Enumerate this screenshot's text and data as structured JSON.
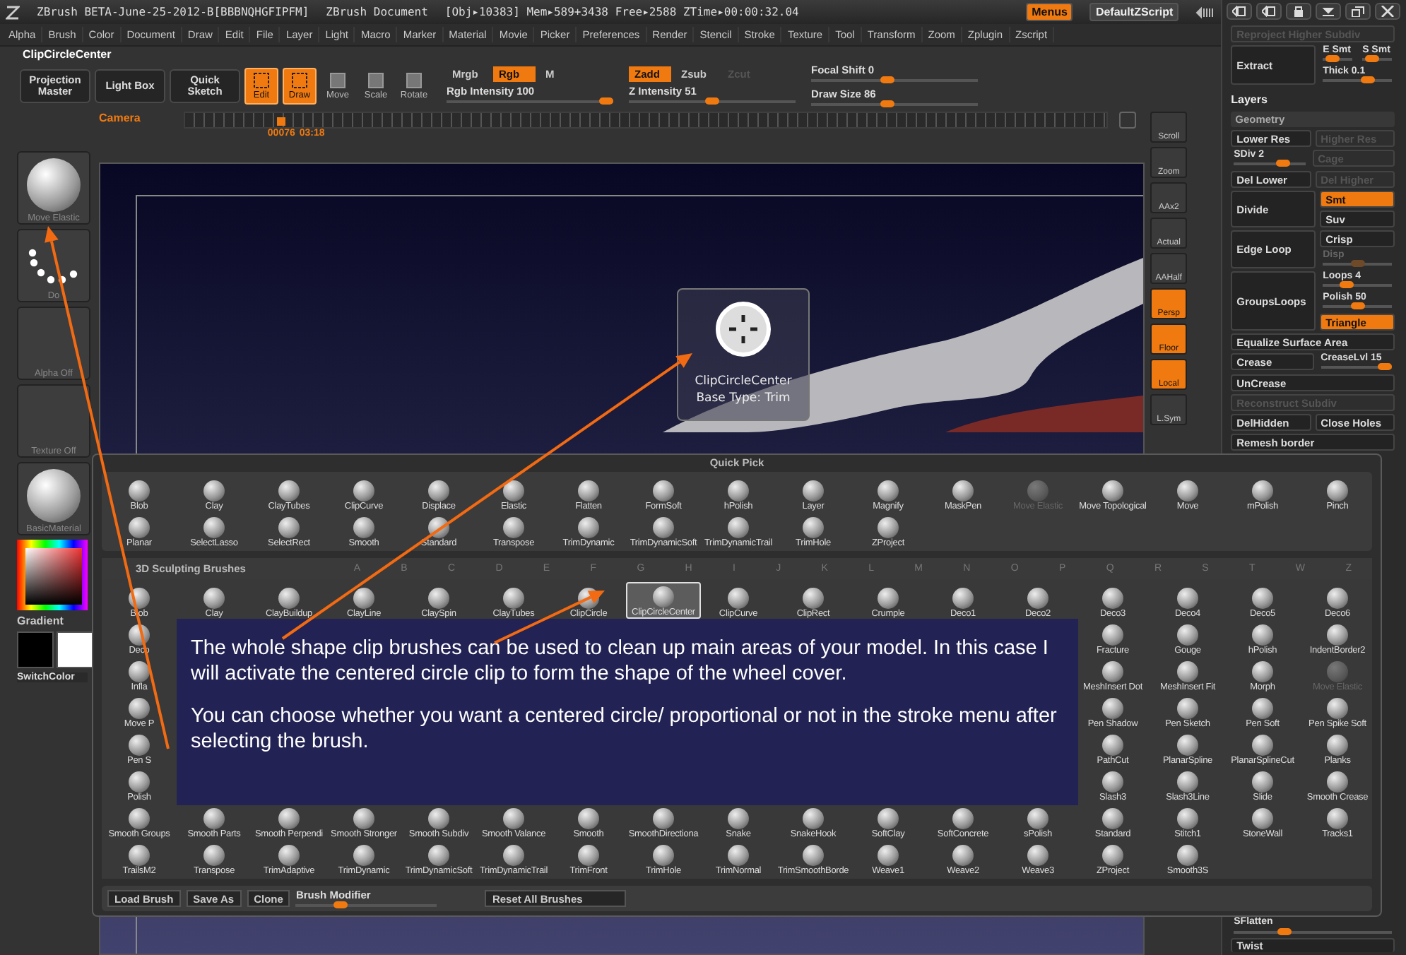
{
  "title_bar": {
    "app": "ZBrush BETA-June-25-2012-B[BBBNQHGFIPFM]",
    "document": "ZBrush Document",
    "stats": "[Obj▸10383] Mem▸589+3438 Free▸2588 ZTime▸00:00:32.04",
    "buttons": [
      {
        "label": "Menus",
        "selected": true
      },
      {
        "label": "DefaultZScript",
        "selected": false
      }
    ]
  },
  "menu_bar": [
    "Alpha",
    "Brush",
    "Color",
    "Document",
    "Draw",
    "Edit",
    "File",
    "Layer",
    "Light",
    "Macro",
    "Marker",
    "Material",
    "Movie",
    "Picker",
    "Preferences",
    "Render",
    "Stencil",
    "Stroke",
    "Texture",
    "Tool",
    "Transform",
    "Zoom",
    "Zplugin",
    "Zscript"
  ],
  "current_tool": "ClipCircleCenter",
  "toolbar": {
    "big_buttons": [
      "Projection Master",
      "Light Box",
      "Quick Sketch"
    ],
    "modes": [
      {
        "label": "Edit",
        "on": true
      },
      {
        "label": "Draw",
        "on": true
      },
      {
        "label": "Move",
        "on": false
      },
      {
        "label": "Scale",
        "on": false
      },
      {
        "label": "Rotate",
        "on": false
      }
    ],
    "groups": [
      {
        "toggles": [
          {
            "label": "Mrgb",
            "on": false,
            "disabled": false
          },
          {
            "label": "Rgb",
            "on": true,
            "disabled": false
          },
          {
            "label": "M",
            "on": false,
            "disabled": false
          }
        ],
        "sliders": [
          {
            "label": "Rgb Intensity 100",
            "level": 1
          }
        ]
      },
      {
        "toggles": [
          {
            "label": "Zadd",
            "on": true,
            "disabled": false
          },
          {
            "label": "Zsub",
            "on": false,
            "disabled": false
          },
          {
            "label": "Zcut",
            "on": false,
            "disabled": true
          }
        ],
        "sliders": [
          {
            "label": "Z Intensity 51",
            "level": 0.5
          }
        ]
      },
      {
        "sliders": [
          {
            "label": "Focal Shift 0",
            "level": 0.45
          },
          {
            "label": "Draw Size 86",
            "level": 0.45
          }
        ]
      }
    ]
  },
  "camera": {
    "label": "Camera",
    "level": 0.1,
    "frame": "00076",
    "time": "03:18"
  },
  "left_shelf": {
    "items": [
      {
        "kind": "sphere",
        "label": "Move Elastic"
      },
      {
        "kind": "dots",
        "label": "Do"
      },
      {
        "kind": "empty",
        "label": "Alpha Off"
      },
      {
        "kind": "empty",
        "label": "Texture Off"
      },
      {
        "kind": "sphere",
        "label": "BasicMaterial"
      }
    ],
    "gradient": "Gradient",
    "switch_color": "SwitchColor"
  },
  "right_shelf": [
    {
      "label": "Scroll",
      "on": false
    },
    {
      "label": "Zoom",
      "on": false
    },
    {
      "label": "AAx2",
      "on": false
    },
    {
      "label": "Actual",
      "on": false
    },
    {
      "label": "AAHalf",
      "on": false
    },
    {
      "label": "Persp",
      "on": true
    },
    {
      "label": "Floor",
      "on": true
    },
    {
      "label": "Local",
      "on": true
    },
    {
      "label": "L.Sym",
      "on": false
    }
  ],
  "tooltip": {
    "title": "ClipCircleCenter",
    "subtitle": "Base Type: Trim"
  },
  "right_panel": {
    "rows": [
      {
        "kind": "button",
        "label": "Reproject Higher Subdiv",
        "disabled": true
      },
      {
        "kind": "block",
        "button": "Extract",
        "items": [
          {
            "kind": "pair",
            "items": [
              {
                "kind": "slider",
                "label": "E Smt",
                "level": 0.2
              },
              {
                "kind": "slider",
                "label": "S Smt",
                "level": 0.2
              }
            ]
          },
          {
            "kind": "slider",
            "label": "Thick 0.1",
            "level": 0.7
          }
        ]
      },
      {
        "kind": "heading",
        "label": "Layers"
      },
      {
        "kind": "subheading",
        "label": "Geometry"
      },
      {
        "kind": "pair",
        "items": [
          {
            "kind": "button",
            "label": "Lower Res",
            "disabled": false
          },
          {
            "kind": "button",
            "label": "Higher Res",
            "disabled": true
          }
        ]
      },
      {
        "kind": "pair",
        "items": [
          {
            "kind": "slider",
            "label": "SDiv 2",
            "level": 0.75
          },
          {
            "kind": "button",
            "label": "Cage",
            "disabled": true
          }
        ]
      },
      {
        "kind": "pair",
        "items": [
          {
            "kind": "button",
            "label": "Del Lower",
            "disabled": false
          },
          {
            "kind": "button",
            "label": "Del Higher",
            "disabled": true
          }
        ]
      },
      {
        "kind": "block",
        "button": "Divide",
        "items": [
          {
            "kind": "toggle",
            "label": "Smt",
            "on": true
          },
          {
            "kind": "toggle",
            "label": "Suv",
            "on": false
          }
        ]
      },
      {
        "kind": "block",
        "button": "Edge Loop",
        "items": [
          {
            "kind": "toggle",
            "label": "Crisp",
            "on": false
          },
          {
            "kind": "slider",
            "label": "Disp",
            "level": 0.5,
            "disabled": true
          }
        ]
      },
      {
        "kind": "block",
        "button": "GroupsLoops",
        "items": [
          {
            "kind": "slider",
            "label": "Loops 4",
            "level": 0.3
          },
          {
            "kind": "slider",
            "label": "Polish 50",
            "level": 0.5
          },
          {
            "kind": "toggle",
            "label": "Triangle",
            "on": true
          }
        ]
      },
      {
        "kind": "button",
        "label": "Equalize Surface Area",
        "disabled": false
      },
      {
        "kind": "pair",
        "items": [
          {
            "kind": "button",
            "label": "Crease",
            "disabled": false
          },
          {
            "kind": "slider",
            "label": "CreaseLvl 15",
            "level": 1
          }
        ]
      },
      {
        "kind": "button",
        "label": "UnCrease",
        "disabled": false
      },
      {
        "kind": "button",
        "label": "Reconstruct Subdiv",
        "disabled": true
      },
      {
        "kind": "pair",
        "items": [
          {
            "kind": "button",
            "label": "DelHidden",
            "disabled": false
          },
          {
            "kind": "button",
            "label": "Close Holes",
            "disabled": false
          }
        ]
      },
      {
        "kind": "button",
        "label": "Remesh border",
        "disabled": false
      }
    ],
    "bottom_rows": [
      {
        "kind": "slider",
        "label": "SFlatten",
        "level": 0.3
      },
      {
        "kind": "button",
        "label": "Twist",
        "disabled": false
      }
    ]
  },
  "brush_palette": {
    "quick_pick": {
      "title": "Quick Pick",
      "rows": [
        [
          {
            "kind": "brush",
            "label": "Blob"
          },
          {
            "kind": "brush",
            "label": "Clay"
          },
          {
            "kind": "brush",
            "label": "ClayTubes"
          },
          {
            "kind": "brush",
            "label": "ClipCurve"
          },
          {
            "kind": "brush",
            "label": "Displace"
          },
          {
            "kind": "brush",
            "label": "Elastic"
          },
          {
            "kind": "brush",
            "label": "Flatten"
          },
          {
            "kind": "brush",
            "label": "FormSoft"
          },
          {
            "kind": "brush",
            "label": "hPolish"
          },
          {
            "kind": "brush",
            "label": "Layer"
          },
          {
            "kind": "brush",
            "label": "Magnify"
          },
          {
            "kind": "brush",
            "label": "MaskPen"
          },
          {
            "kind": "dim",
            "label": "Move Elastic"
          },
          {
            "kind": "brush",
            "label": "Move Topological"
          },
          {
            "kind": "brush",
            "label": "Move"
          },
          {
            "kind": "brush",
            "label": "mPolish"
          },
          {
            "kind": "brush",
            "label": "Pinch"
          }
        ],
        [
          {
            "kind": "brush",
            "label": "Planar"
          },
          {
            "kind": "brush",
            "label": "SelectLasso"
          },
          {
            "kind": "brush",
            "label": "SelectRect"
          },
          {
            "kind": "brush",
            "label": "Smooth"
          },
          {
            "kind": "brush",
            "label": "Standard"
          },
          {
            "kind": "brush",
            "label": "Transpose"
          },
          {
            "kind": "brush",
            "label": "TrimDynamic"
          },
          {
            "kind": "brush",
            "label": "TrimDynamicSoft"
          },
          {
            "kind": "brush",
            "label": "TrimDynamicTrail"
          },
          {
            "kind": "brush",
            "label": "TrimHole"
          },
          {
            "kind": "brush",
            "label": "ZProject"
          }
        ]
      ]
    },
    "library": {
      "title": "3D Sculpting Brushes",
      "letters": [
        "A",
        "B",
        "C",
        "D",
        "E",
        "F",
        "G",
        "H",
        "I",
        "J",
        "K",
        "L",
        "M",
        "N",
        "O",
        "P",
        "Q",
        "R",
        "S",
        "T",
        "W",
        "Z"
      ],
      "rows": [
        {
          "cells": [
            {
              "kind": "brush",
              "label": "Blob",
              "selected": false
            },
            {
              "kind": "brush",
              "label": "Clay",
              "selected": false
            },
            {
              "kind": "brush",
              "label": "ClayBuildup",
              "selected": false
            },
            {
              "kind": "brush",
              "label": "ClayLine",
              "selected": false
            },
            {
              "kind": "brush",
              "label": "ClaySpin",
              "selected": false
            },
            {
              "kind": "brush",
              "label": "ClayTubes",
              "selected": false
            },
            {
              "kind": "brush",
              "label": "ClipCircle",
              "selected": false
            },
            {
              "kind": "brush",
              "label": "ClipCircleCenter",
              "selected": true
            },
            {
              "kind": "brush",
              "label": "ClipCurve",
              "selected": false
            },
            {
              "kind": "brush",
              "label": "ClipRect",
              "selected": false
            },
            {
              "kind": "brush",
              "label": "Crumple",
              "selected": false
            },
            {
              "kind": "brush",
              "label": "Deco1",
              "selected": false
            },
            {
              "kind": "brush",
              "label": "Deco2",
              "selected": false
            },
            {
              "kind": "brush",
              "label": "Deco3",
              "selected": false
            },
            {
              "kind": "brush",
              "label": "Deco4",
              "selected": false
            },
            {
              "kind": "brush",
              "label": "Deco5",
              "selected": false
            },
            {
              "kind": "brush",
              "label": "Deco6",
              "selected": false
            }
          ]
        },
        {
          "cells": [
            {
              "kind": "brush",
              "label": "Deco",
              "selected": false
            }
          ],
          "after_gap": [
            {
              "kind": "brush",
              "label": "Fracture",
              "selected": false
            },
            {
              "kind": "brush",
              "label": "Gouge",
              "selected": false
            },
            {
              "kind": "brush",
              "label": "hPolish",
              "selected": false
            },
            {
              "kind": "brush",
              "label": "IndentBorder2",
              "selected": false
            }
          ]
        },
        {
          "cells": [
            {
              "kind": "brush",
              "label": "Infla",
              "selected": false
            }
          ],
          "after_gap": [
            {
              "kind": "brush",
              "label": "MeshInsert Dot",
              "selected": false
            },
            {
              "kind": "brush",
              "label": "MeshInsert Fit",
              "selected": false
            },
            {
              "kind": "brush",
              "label": "Morph",
              "selected": false
            },
            {
              "kind": "dim",
              "label": "Move Elastic",
              "selected": false
            }
          ]
        },
        {
          "cells": [
            {
              "kind": "brush",
              "label": "Move P",
              "selected": false
            }
          ],
          "after_gap": [
            {
              "kind": "brush",
              "label": "Pen Shadow",
              "selected": false
            },
            {
              "kind": "brush",
              "label": "Pen Sketch",
              "selected": false
            },
            {
              "kind": "brush",
              "label": "Pen Soft",
              "selected": false
            },
            {
              "kind": "brush",
              "label": "Pen Spike Soft",
              "selected": false
            }
          ]
        },
        {
          "cells": [
            {
              "kind": "brush",
              "label": "Pen S",
              "selected": false
            }
          ],
          "after_gap": [
            {
              "kind": "brush",
              "label": "PathCut",
              "selected": false
            },
            {
              "kind": "brush",
              "label": "PlanarSpline",
              "selected": false
            },
            {
              "kind": "brush",
              "label": "PlanarSplineCut",
              "selected": false
            },
            {
              "kind": "brush",
              "label": "Planks",
              "selected": false
            }
          ]
        },
        {
          "cells": [
            {
              "kind": "brush",
              "label": "Polish",
              "selected": false
            }
          ],
          "after_gap": [
            {
              "kind": "brush",
              "label": "Slash3",
              "selected": false
            },
            {
              "kind": "brush",
              "label": "Slash3Line",
              "selected": false
            },
            {
              "kind": "brush",
              "label": "Slide",
              "selected": false
            },
            {
              "kind": "brush",
              "label": "Smooth Crease",
              "selected": false
            }
          ]
        },
        {
          "cells": [
            {
              "kind": "brush",
              "label": "Smooth Groups",
              "selected": false
            },
            {
              "kind": "brush",
              "label": "Smooth Parts",
              "selected": false
            },
            {
              "kind": "brush",
              "label": "Smooth Perpendi",
              "selected": false
            },
            {
              "kind": "brush",
              "label": "Smooth Stronger",
              "selected": false
            },
            {
              "kind": "brush",
              "label": "Smooth Subdiv",
              "selected": false
            },
            {
              "kind": "brush",
              "label": "Smooth Valance",
              "selected": false
            },
            {
              "kind": "brush",
              "label": "Smooth",
              "selected": false
            },
            {
              "kind": "brush",
              "label": "SmoothDirectiona",
              "selected": false
            },
            {
              "kind": "brush",
              "label": "Snake",
              "selected": false
            },
            {
              "kind": "brush",
              "label": "SnakeHook",
              "selected": false
            },
            {
              "kind": "brush",
              "label": "SoftClay",
              "selected": false
            },
            {
              "kind": "brush",
              "label": "SoftConcrete",
              "selected": false
            },
            {
              "kind": "brush",
              "label": "sPolish",
              "selected": false
            },
            {
              "kind": "brush",
              "label": "Standard",
              "selected": false
            },
            {
              "kind": "brush",
              "label": "Stitch1",
              "selected": false
            },
            {
              "kind": "brush",
              "label": "StoneWall",
              "selected": false
            },
            {
              "kind": "brush",
              "label": "Tracks1",
              "selected": false
            }
          ]
        },
        {
          "cells": [
            {
              "kind": "brush",
              "label": "TrailsM2",
              "selected": false
            },
            {
              "kind": "brush",
              "label": "Transpose",
              "selected": false
            },
            {
              "kind": "brush",
              "label": "TrimAdaptive",
              "selected": false
            },
            {
              "kind": "brush",
              "label": "TrimDynamic",
              "selected": false
            },
            {
              "kind": "brush",
              "label": "TrimDynamicSoft",
              "selected": false
            },
            {
              "kind": "brush",
              "label": "TrimDynamicTrail",
              "selected": false
            },
            {
              "kind": "brush",
              "label": "TrimFront",
              "selected": false
            },
            {
              "kind": "brush",
              "label": "TrimHole",
              "selected": false
            },
            {
              "kind": "brush",
              "label": "TrimNormal",
              "selected": false
            },
            {
              "kind": "brush",
              "label": "TrimSmoothBorde",
              "selected": false
            },
            {
              "kind": "brush",
              "label": "Weave1",
              "selected": false
            },
            {
              "kind": "brush",
              "label": "Weave2",
              "selected": false
            },
            {
              "kind": "brush",
              "label": "Weave3",
              "selected": false
            },
            {
              "kind": "brush",
              "label": "ZProject",
              "selected": false
            },
            {
              "kind": "brush",
              "label": "Smooth3S",
              "selected": false
            }
          ]
        }
      ]
    },
    "bottom_bar": {
      "buttons": [
        "Load Brush",
        "Save As",
        "Clone"
      ],
      "slider": {
        "label": "Brush Modifier",
        "level": 0.3
      },
      "reset": "Reset All Brushes"
    }
  },
  "annotation": {
    "paragraphs": [
      "The whole shape clip brushes can be used to clean up main areas of your model. In this case I will activate the centered circle clip to form the shape of the wheel cover.",
      "You can choose whether you want a centered circle/ proportional or not in the stroke menu after selecting the brush."
    ]
  }
}
